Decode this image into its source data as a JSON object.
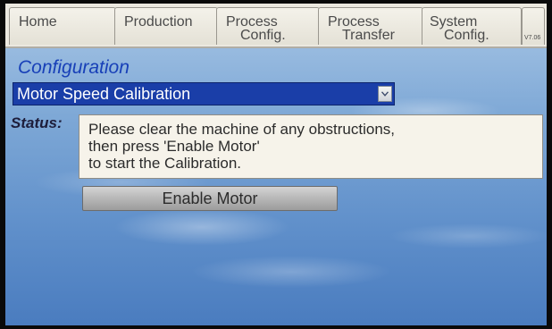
{
  "tabs": [
    {
      "line1": "Home",
      "line2": ""
    },
    {
      "line1": "Production",
      "line2": ""
    },
    {
      "line1": "Process",
      "line2": "Config."
    },
    {
      "line1": "Process",
      "line2": "Transfer"
    },
    {
      "line1": "System",
      "line2": "Config."
    },
    {
      "line1": "V7.06",
      "line2": ""
    }
  ],
  "active_tab": "System Config.",
  "configuration": {
    "heading": "Configuration",
    "selected_option": "Motor Speed Calibration"
  },
  "status": {
    "label": "Status:",
    "lines": [
      "Please clear the machine of any obstructions,",
      "then press 'Enable Motor'",
      "to start the Calibration."
    ]
  },
  "buttons": {
    "enable_motor": "Enable Motor"
  },
  "icons": {
    "dropdown": "chevron-down-icon"
  },
  "colors": {
    "heading": "#1840b8",
    "select_background": "#1a3ea8",
    "screen_background": "#6d9bd0"
  }
}
